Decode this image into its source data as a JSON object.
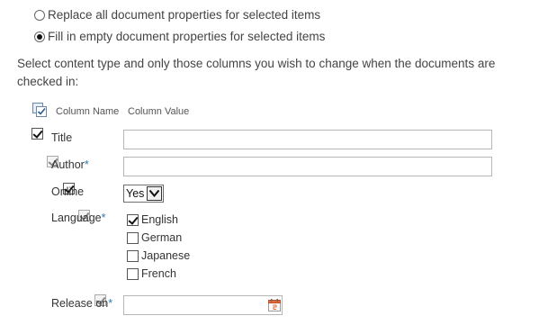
{
  "options": {
    "replace_label": "Replace all document properties for selected items",
    "fill_label": "Fill in empty document properties for selected items",
    "selected": "fill"
  },
  "instructions": "Select content type and only those columns you wish to change when the documents are checked in:",
  "columns_header": {
    "select_all_icon": "select-all-icon",
    "name": "Column Name",
    "value": "Column Value"
  },
  "fields": {
    "title": {
      "label": "Title",
      "required": false,
      "checked": true,
      "enabled": true,
      "value": ""
    },
    "author": {
      "label": "Author",
      "required_mark": "*",
      "checked": true,
      "enabled": false,
      "value": ""
    },
    "online": {
      "label": "Online",
      "checked": true,
      "enabled": true,
      "selected_value": "Yes"
    },
    "language": {
      "label": "Language",
      "required_mark": "*",
      "checked": true,
      "enabled": false,
      "options": [
        {
          "label": "English",
          "checked": true
        },
        {
          "label": "German",
          "checked": false
        },
        {
          "label": "Japanese",
          "checked": false
        },
        {
          "label": "French",
          "checked": false
        }
      ]
    },
    "release_on": {
      "label": "Release on",
      "required_mark": "*",
      "checked": true,
      "enabled": false,
      "value": "",
      "icon": "calendar-icon"
    }
  },
  "colors": {
    "required": "#2a7ab0",
    "text": "#333333",
    "border": "#b6b6b6"
  }
}
